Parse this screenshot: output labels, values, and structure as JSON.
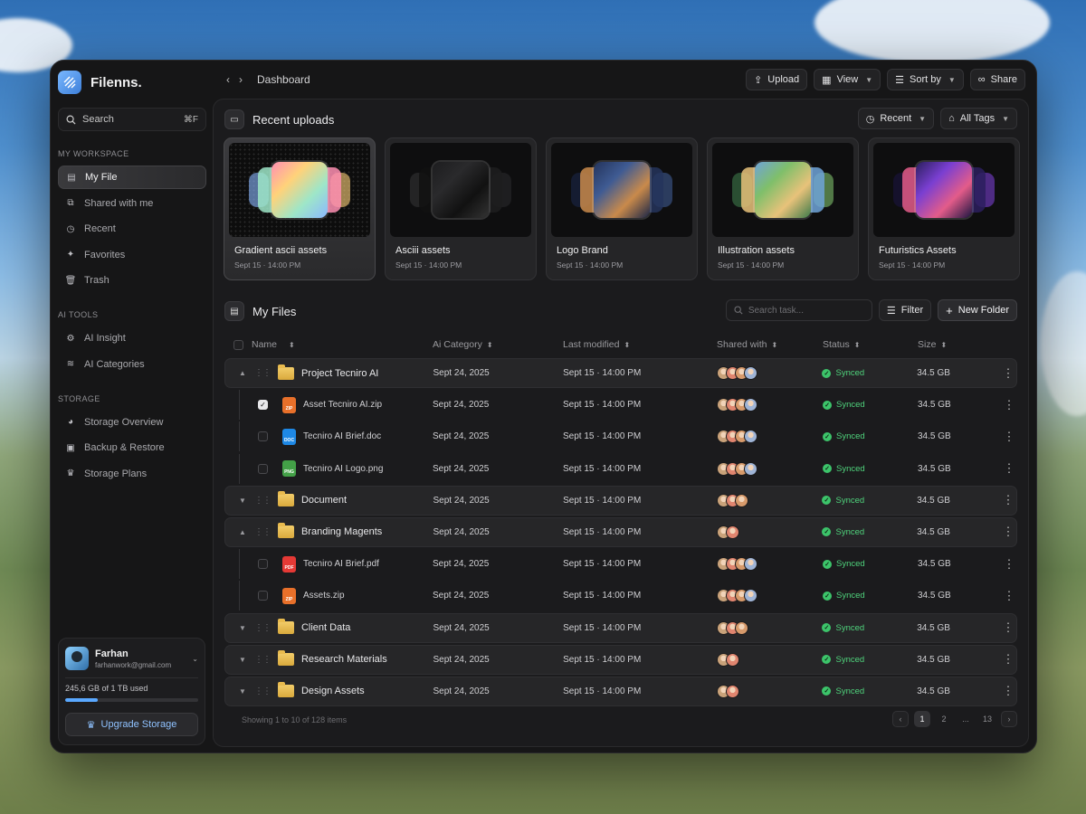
{
  "app": {
    "name": "Filenns."
  },
  "sidebar": {
    "search": {
      "label": "Search",
      "shortcut": "⌘F"
    },
    "sections": [
      {
        "label": "MY WORKSPACE",
        "items": [
          {
            "label": "My File",
            "icon": "file-box-icon",
            "active": true
          },
          {
            "label": "Shared with me",
            "icon": "shared-icon"
          },
          {
            "label": "Recent",
            "icon": "clock-icon"
          },
          {
            "label": "Favorites",
            "icon": "sparkle-icon"
          },
          {
            "label": "Trash",
            "icon": "trash-icon"
          }
        ]
      },
      {
        "label": "AI TOOLS",
        "items": [
          {
            "label": "AI Insight",
            "icon": "gear-icon"
          },
          {
            "label": "AI Categories",
            "icon": "layers-icon"
          }
        ]
      },
      {
        "label": "STORAGE",
        "items": [
          {
            "label": "Storage Overview",
            "icon": "pie-icon"
          },
          {
            "label": "Backup & Restore",
            "icon": "archive-icon"
          },
          {
            "label": "Storage Plans",
            "icon": "crown-icon"
          }
        ]
      }
    ],
    "user": {
      "name": "Farhan",
      "email": "farhanwork@gmail.com",
      "storage_text": "245,6 GB of 1 TB used",
      "storage_fraction": 0.245,
      "upgrade_label": "Upgrade Storage"
    }
  },
  "topbar": {
    "breadcrumb": "Dashboard",
    "actions": {
      "upload": "Upload",
      "view": "View",
      "sort": "Sort by",
      "share": "Share"
    }
  },
  "recent": {
    "title": "Recent uploads",
    "filter_recent": "Recent",
    "filter_tags": "All Tags",
    "cards": [
      {
        "title": "Gradient ascii assets",
        "date": "Sept 15",
        "time": "14:00 PM",
        "active": true
      },
      {
        "title": "Asciii assets",
        "date": "Sept 15",
        "time": "14:00 PM"
      },
      {
        "title": "Logo Brand",
        "date": "Sept 15",
        "time": "14:00 PM"
      },
      {
        "title": "Illustration assets",
        "date": "Sept 15",
        "time": "14:00 PM"
      },
      {
        "title": "Futuristics Assets",
        "date": "Sept 15",
        "time": "14:00 PM"
      }
    ]
  },
  "files": {
    "title": "My Files",
    "search_placeholder": "Search task...",
    "filter_label": "Filter",
    "new_folder_label": "New Folder",
    "columns": {
      "name": "Name",
      "category": "Ai Category",
      "modified": "Last modified",
      "shared": "Shared with",
      "status": "Status",
      "size": "Size"
    },
    "rows": [
      {
        "kind": "folder",
        "name": "Project Tecniro AI",
        "expanded": true,
        "category": "Sept 24, 2025",
        "modified_date": "Sept 15",
        "modified_time": "14:00 PM",
        "avatars": 4,
        "status": "Synced",
        "size": "34.5 GB"
      },
      {
        "kind": "file",
        "ext": "ZIP",
        "ext_color": "#e8702a",
        "checked": true,
        "name": "Asset Tecniro AI.zip",
        "category": "Sept 24, 2025",
        "modified_date": "Sept 15",
        "modified_time": "14:00 PM",
        "avatars": 4,
        "status": "Synced",
        "size": "34.5 GB"
      },
      {
        "kind": "file",
        "ext": "DOC",
        "ext_color": "#1e88e5",
        "name": "Tecniro AI Brief.doc",
        "category": "Sept 24, 2025",
        "modified_date": "Sept 15",
        "modified_time": "14:00 PM",
        "avatars": 4,
        "status": "Synced",
        "size": "34.5 GB"
      },
      {
        "kind": "file",
        "ext": "PNG",
        "ext_color": "#43a047",
        "name": "Tecniro AI Logo.png",
        "category": "Sept 24, 2025",
        "modified_date": "Sept 15",
        "modified_time": "14:00 PM",
        "avatars": 4,
        "status": "Synced",
        "size": "34.5 GB"
      },
      {
        "kind": "folder",
        "name": "Document",
        "category": "Sept 24, 2025",
        "modified_date": "Sept 15",
        "modified_time": "14:00 PM",
        "avatars": 3,
        "status": "Synced",
        "size": "34.5 GB"
      },
      {
        "kind": "folder",
        "name": "Branding Magents",
        "expanded": true,
        "category": "Sept 24, 2025",
        "modified_date": "Sept 15",
        "modified_time": "14:00 PM",
        "avatars": 2,
        "status": "Synced",
        "size": "34.5 GB"
      },
      {
        "kind": "file",
        "ext": "PDF",
        "ext_color": "#e53935",
        "name": "Tecniro AI Brief.pdf",
        "category": "Sept 24, 2025",
        "modified_date": "Sept 15",
        "modified_time": "14:00 PM",
        "avatars": 4,
        "status": "Synced",
        "size": "34.5 GB"
      },
      {
        "kind": "file",
        "ext": "ZIP",
        "ext_color": "#e8702a",
        "name": "Assets.zip",
        "category": "Sept 24, 2025",
        "modified_date": "Sept 15",
        "modified_time": "14:00 PM",
        "avatars": 4,
        "status": "Synced",
        "size": "34.5 GB"
      },
      {
        "kind": "folder",
        "name": "Client Data",
        "category": "Sept 24, 2025",
        "modified_date": "Sept 15",
        "modified_time": "14:00 PM",
        "avatars": 3,
        "status": "Synced",
        "size": "34.5 GB"
      },
      {
        "kind": "folder",
        "name": "Research  Materials",
        "category": "Sept 24, 2025",
        "modified_date": "Sept 15",
        "modified_time": "14:00 PM",
        "avatars": 2,
        "status": "Synced",
        "size": "34.5 GB"
      },
      {
        "kind": "folder",
        "name": "Design Assets",
        "category": "Sept 24, 2025",
        "modified_date": "Sept 15",
        "modified_time": "14:00 PM",
        "avatars": 2,
        "status": "Synced",
        "size": "34.5 GB"
      }
    ],
    "footer_text": "Showing 1 to 10 of 128 items",
    "pages": [
      "1",
      "2",
      "...",
      "13"
    ]
  },
  "colors": {
    "accent": "#5aa8ff",
    "synced": "#4fd37c"
  }
}
